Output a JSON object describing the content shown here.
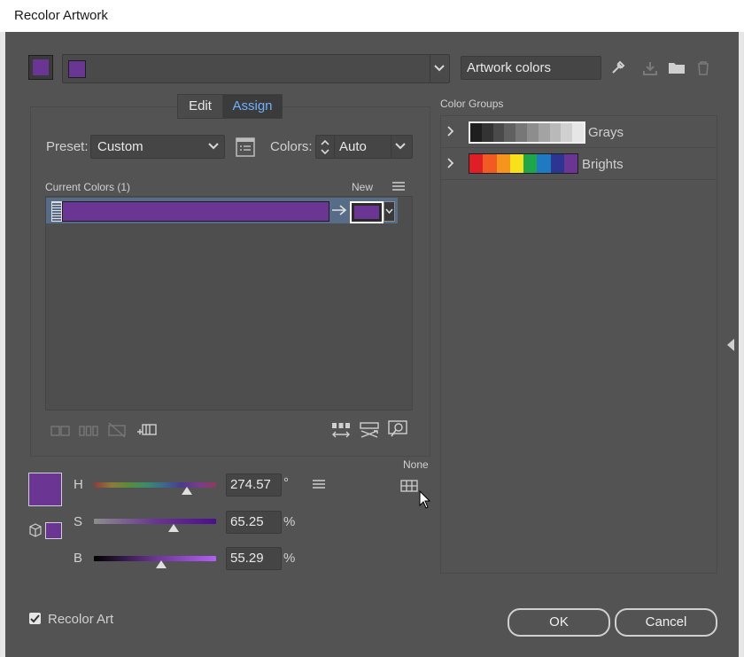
{
  "window": {
    "title": "Recolor Artwork"
  },
  "top": {
    "colorgroup_name": "Artwork colors",
    "swatch_color": "#6a3593"
  },
  "tabs": [
    {
      "label": "Edit"
    },
    {
      "label": "Assign"
    }
  ],
  "assign": {
    "preset_label": "Preset:",
    "preset_value": "Custom",
    "colors_label": "Colors:",
    "colors_value": "Auto",
    "current_colors_label": "Current Colors (1)",
    "new_label": "New",
    "current_color": "#6a3593"
  },
  "color_groups": {
    "label": "Color Groups",
    "groups": [
      {
        "name": "Grays",
        "swatches": [
          "#1e1e1e",
          "#333333",
          "#4a4a4a",
          "#606060",
          "#777777",
          "#8d8d8d",
          "#a3a3a3",
          "#b9b9b9",
          "#d0d0d0",
          "#e6e6e6"
        ]
      },
      {
        "name": "Brights",
        "swatches": [
          "#e01e26",
          "#f15a22",
          "#f7941d",
          "#f6e11b",
          "#1fa64a",
          "#1f7bc1",
          "#2c3591",
          "#6a3593"
        ]
      }
    ]
  },
  "hsb": {
    "h_label": "H",
    "h_value": "274.57",
    "h_unit": "°",
    "s_label": "S",
    "s_value": "65.25",
    "s_unit": "%",
    "b_label": "B",
    "b_value": "55.29",
    "b_unit": "%",
    "h_fraction": 0.763,
    "s_fraction": 0.6525,
    "b_fraction": 0.5529,
    "none_label": "None"
  },
  "footer": {
    "recolor_art_label": "Recolor Art",
    "recolor_art_checked": true,
    "ok_label": "OK",
    "cancel_label": "Cancel"
  }
}
